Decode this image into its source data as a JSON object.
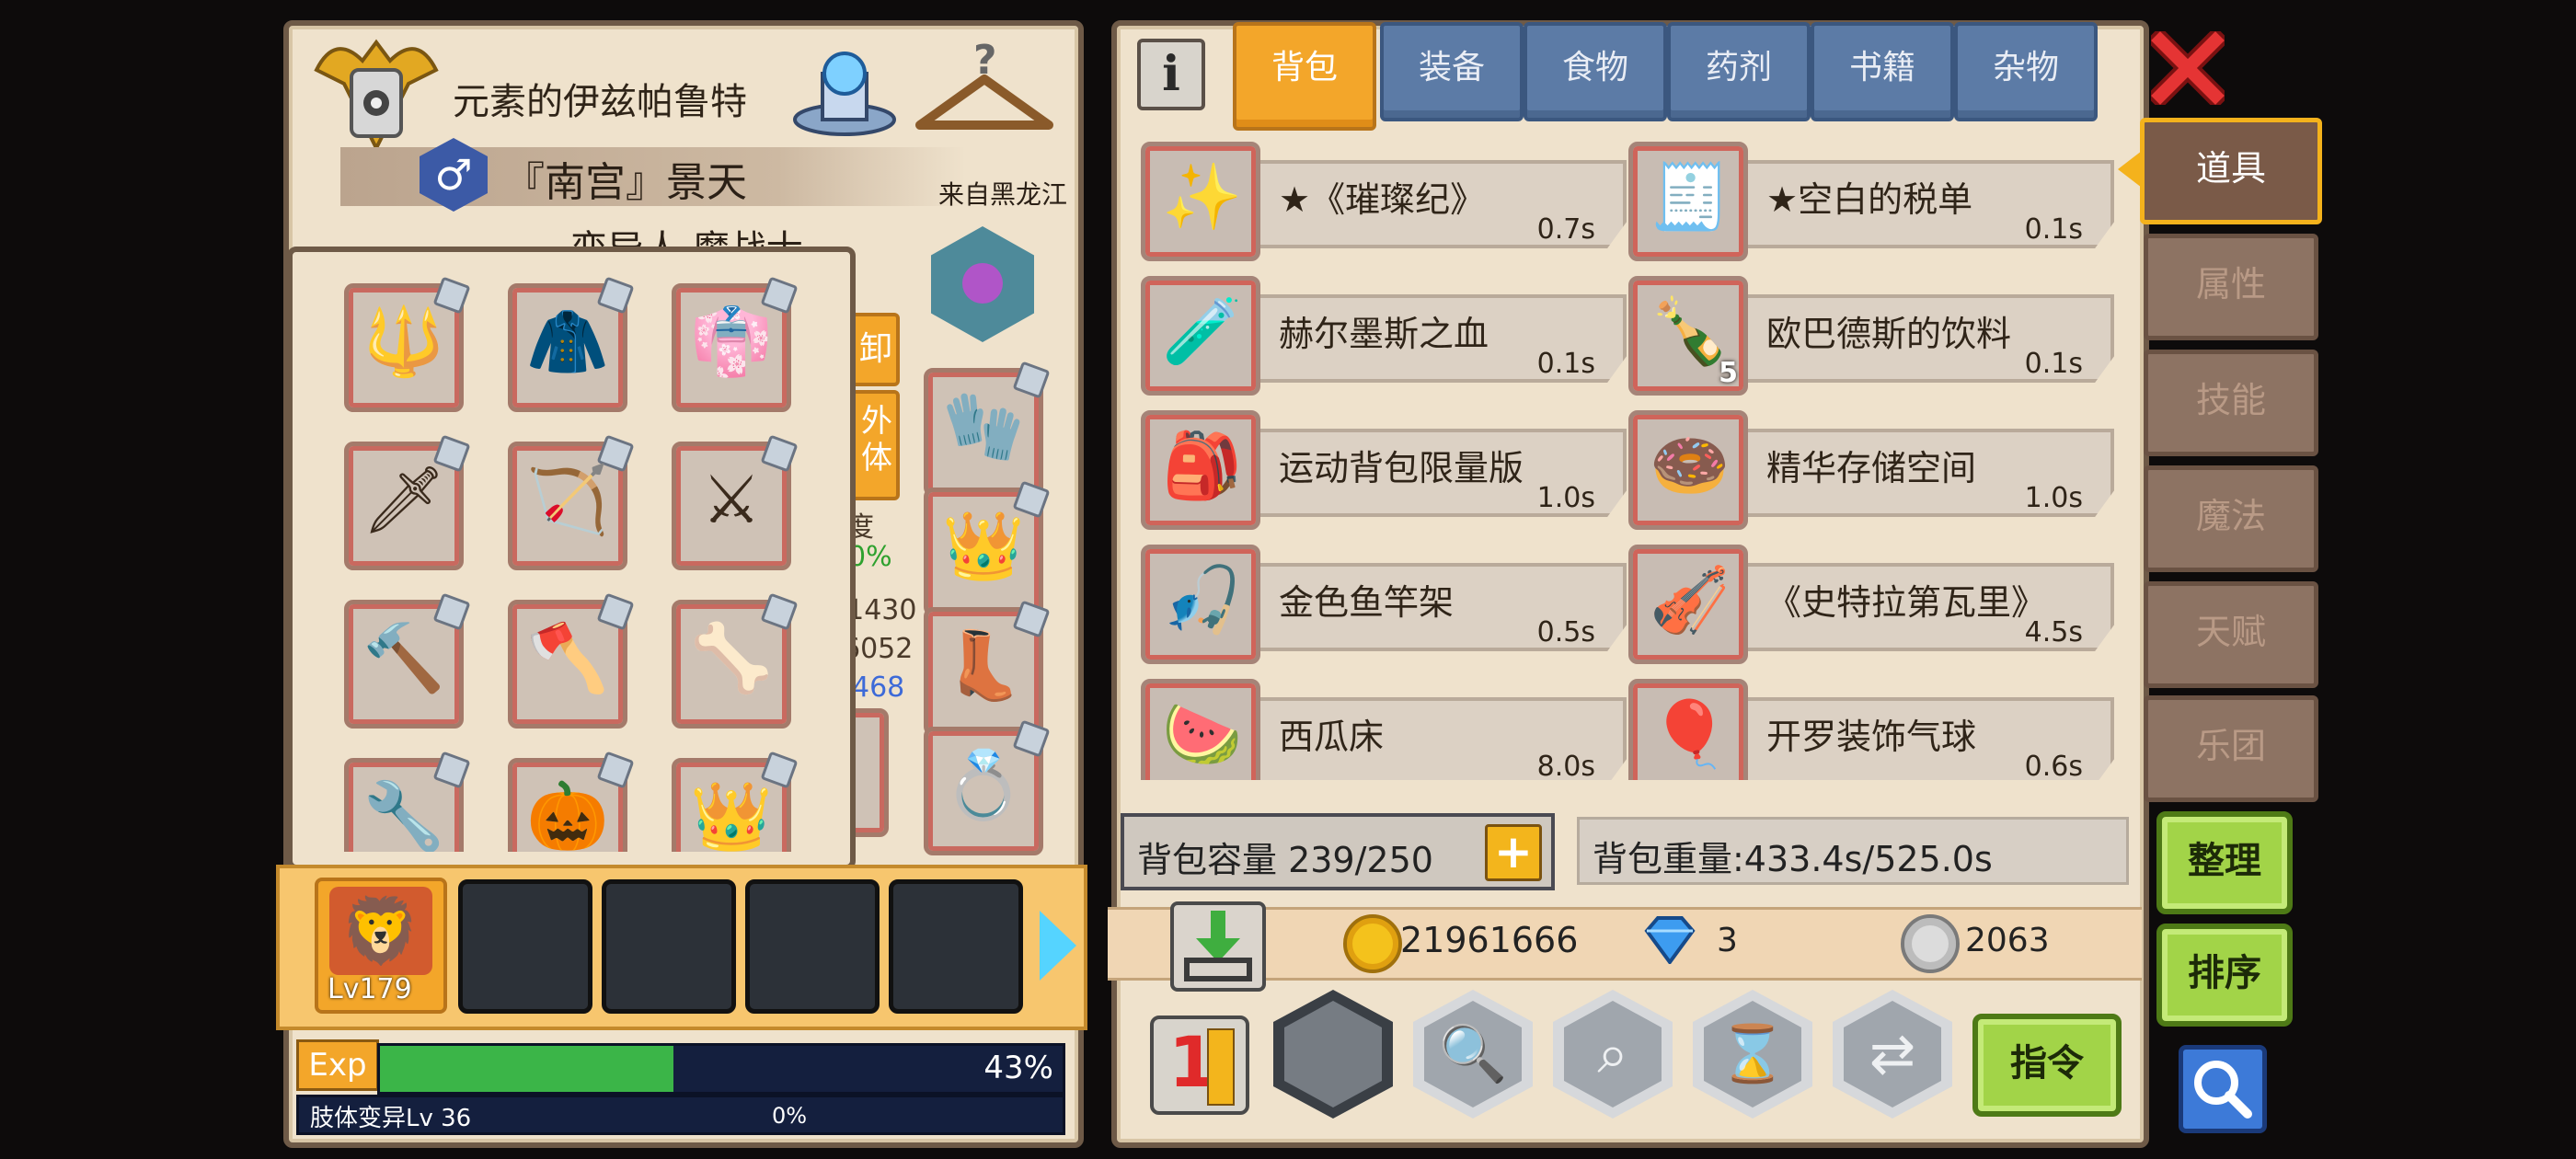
{
  "character": {
    "title": "元素的伊兹帕鲁特",
    "name": "『南宫』景天",
    "origin": "来自黑龙江",
    "class": "变异人 魔战士",
    "gender_symbol": "♂",
    "side_btn_1": "卸",
    "side_btn_2": "外体",
    "stat_label": "度",
    "stat_pct": "0%",
    "stat_hp": "/1430",
    "stat_2": "6052",
    "stat_3": "468",
    "level": "Lv179",
    "exp_label": "Exp",
    "exp_percent": 43,
    "exp_text": "43%",
    "sub_label": "肢体变异Lv 36",
    "sub_percent": "0%"
  },
  "equipment_icons": [
    "horned-helmet",
    "blue-cape",
    "red-cape",
    "fire-spear",
    "jade-crossbow",
    "red-fan-sword",
    "flame-hammer",
    "red-glaive",
    "bone-axe",
    "silver-wrench",
    "pumpkin-charm",
    "purple-crown"
  ],
  "right_equipment_icons": [
    "teal-shield",
    "white-glove",
    "red-crown-ring",
    "stone-boots",
    "blue-ring"
  ],
  "tabs": [
    "背包",
    "装备",
    "食物",
    "药剂",
    "书籍",
    "杂物"
  ],
  "active_tab": "背包",
  "items": [
    {
      "name": "★《璀璨纪》",
      "time": "0.7s",
      "icon": "golden-scepter-icon",
      "glyph": "✨",
      "count": ""
    },
    {
      "name": "★空白的税单",
      "time": "0.1s",
      "icon": "tax-form-icon",
      "glyph": "🧾",
      "count": ""
    },
    {
      "name": "赫尔墨斯之血",
      "time": "0.1s",
      "icon": "potion-icon",
      "glyph": "🧪",
      "count": ""
    },
    {
      "name": "欧巴德斯的饮料",
      "time": "0.1s",
      "icon": "bottle-icon",
      "glyph": "🍾",
      "count": "5"
    },
    {
      "name": "运动背包限量版",
      "time": "1.0s",
      "icon": "backpack-icon",
      "glyph": "🎒",
      "count": ""
    },
    {
      "name": "精华存储空间",
      "time": "1.0s",
      "icon": "ring-pouch-icon",
      "glyph": "🍩",
      "count": ""
    },
    {
      "name": "金色鱼竿架",
      "time": "0.5s",
      "icon": "rod-rack-icon",
      "glyph": "🎣",
      "count": ""
    },
    {
      "name": "《史特拉第瓦里》",
      "time": "4.5s",
      "icon": "violin-icon",
      "glyph": "🎻",
      "count": ""
    },
    {
      "name": "西瓜床",
      "time": "8.0s",
      "icon": "watermelon-bed-icon",
      "glyph": "🍉",
      "count": ""
    },
    {
      "name": "开罗装饰气球",
      "time": "0.6s",
      "icon": "balloon-icon",
      "glyph": "🎈",
      "count": ""
    }
  ],
  "bag": {
    "capacity_label": "背包容量 239/250",
    "weight_label": "背包重量:433.4s/525.0s",
    "gold": "21961666",
    "diamond": "3",
    "silver": "2063"
  },
  "side_tabs": [
    "道具",
    "属性",
    "技能",
    "魔法",
    "天赋",
    "乐团"
  ],
  "active_side_tab": "道具",
  "buttons": {
    "sort": "整理",
    "order": "排序",
    "command": "指令",
    "number_badge": "1"
  },
  "colors": {
    "panel_bg": "#efe2cc",
    "tab_blue": "#5c7ba6",
    "tab_active": "#f3a62a",
    "exp_green": "#3bb548",
    "button_green": "#a2d448",
    "close_red": "#e53434"
  }
}
